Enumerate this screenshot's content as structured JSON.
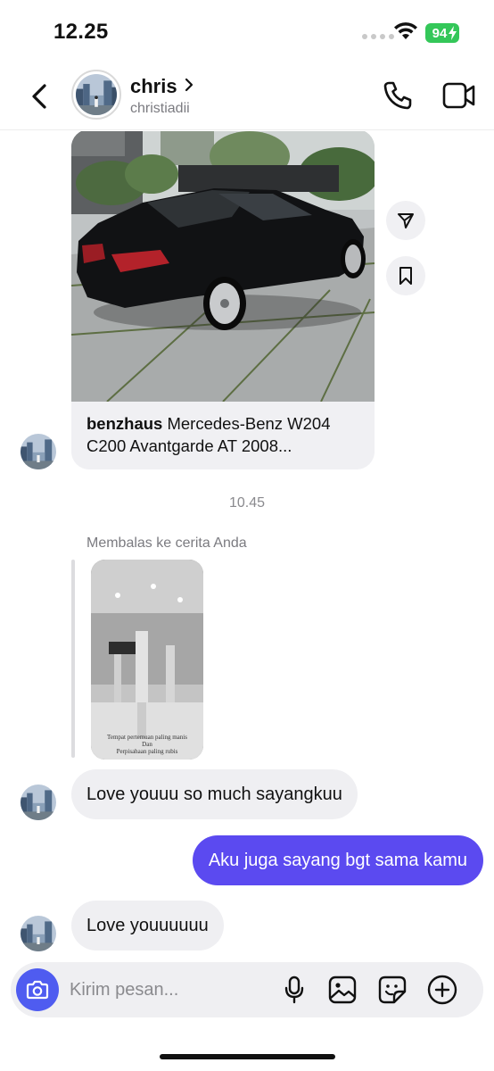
{
  "status_bar": {
    "time": "12.25",
    "battery": "94"
  },
  "header": {
    "name": "chris",
    "username": "christiadii",
    "icons": {
      "back": "chevron-left-icon",
      "call": "phone-icon",
      "video": "video-camera-icon"
    }
  },
  "messages": {
    "shared_post": {
      "account": "benzhaus",
      "caption": "Mercedes-Benz W204 C200 Avantgarde AT 2008..."
    },
    "timestamp": "10.45",
    "reply_label": "Membalas ke cerita Anda",
    "story_caption_line1": "Tempat pertemuan paling manis",
    "story_caption_line2": "Dan",
    "story_caption_line3": "Perpisahaan paling rubis",
    "incoming_1": "Love youuu so much sayangkuu",
    "outgoing_1": "Aku juga sayang bgt sama kamu",
    "incoming_2": "Love youuuuuu"
  },
  "composer": {
    "placeholder": "Kirim pesan...",
    "icons": [
      "camera-icon",
      "microphone-icon",
      "image-icon",
      "sticker-icon",
      "plus-icon"
    ]
  },
  "colors": {
    "accent": "#5b4af0",
    "camera_button": "#4f5cf0",
    "bubble_in": "#efeff2",
    "battery": "#34c759"
  }
}
